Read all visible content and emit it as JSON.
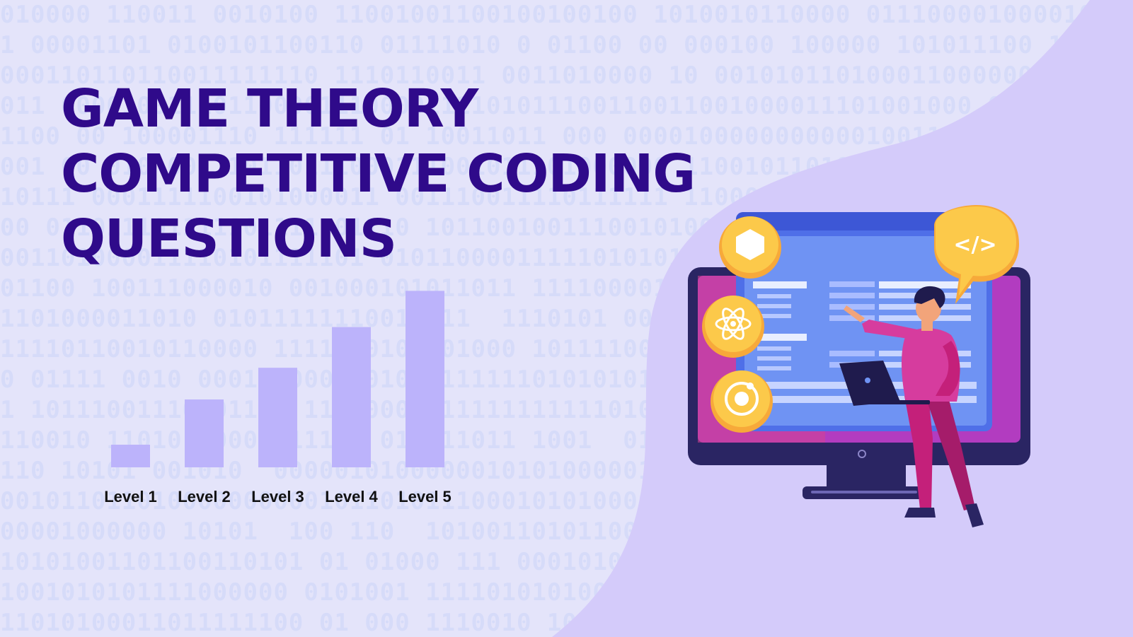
{
  "title": {
    "line1": "GAME THEORY",
    "line2": "COMPETITIVE CODING",
    "line3": "QUESTIONS"
  },
  "colors": {
    "background": "#e4e4fa",
    "blob": "#d4cbfa",
    "title": "#2f0a8a",
    "bar": "#bcb3fb"
  },
  "chart_data": {
    "type": "bar",
    "categories": [
      "Level 1",
      "Level 2",
      "Level 3",
      "Level 4",
      "Level 5"
    ],
    "values": [
      1,
      3,
      4.4,
      6.2,
      7.8
    ],
    "title": "",
    "xlabel": "",
    "ylabel": "",
    "ylim": [
      0,
      8
    ]
  },
  "illustration": {
    "code_icon_text": "</>",
    "icons": [
      "hexagon-icon",
      "atom-icon",
      "ring-icon",
      "code-bubble-icon"
    ]
  }
}
